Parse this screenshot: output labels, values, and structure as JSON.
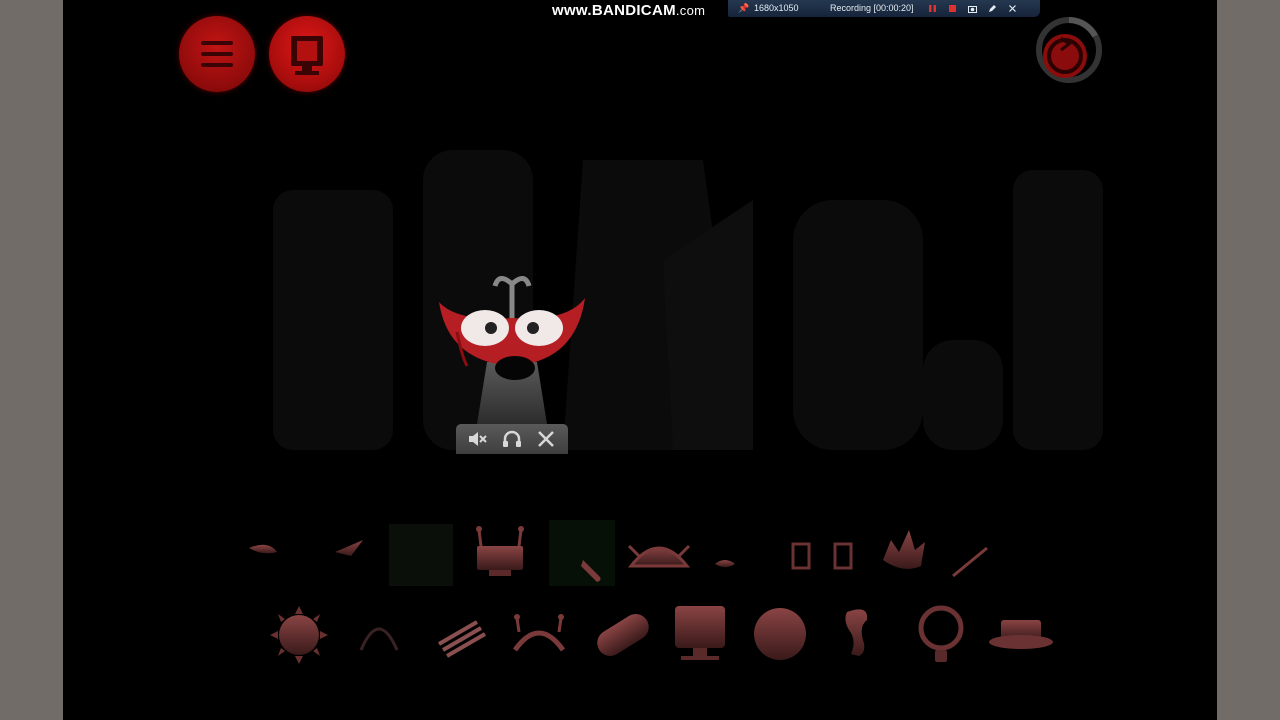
{
  "recorder": {
    "watermark_main": "www.BANDICAM",
    "watermark_domain": ".com",
    "resolution": "1680x1050",
    "status": "Recording [00:00:20]"
  },
  "controls": {
    "menu_icon": "hamburger-icon",
    "special_icon": "cup-icon",
    "reset_icon": "reset-ring-icon"
  },
  "mini_panel": {
    "icons": [
      "mute-icon",
      "headphones-icon",
      "close-icon"
    ]
  },
  "palette": {
    "row1": [
      "nose-icon",
      "beak-icon",
      "dark-box-icon",
      "antenna-screen-icon",
      "green-hook-icon",
      "horned-helmet-icon",
      "small-eye-icon",
      "goggles-icon",
      "spiky-hair-icon",
      "stick-icon"
    ],
    "row2": [
      "sun-face-icon",
      "arc-icon",
      "stripes-icon",
      "horned-eyes-icon",
      "pill-icon",
      "monitor-icon",
      "sphere-icon",
      "hook-figure-icon",
      "ring-icon",
      "hat-icon"
    ]
  },
  "colors": {
    "accent_red": "#c21414",
    "palette_tint": "#6e3434",
    "stage_bg": "#000000",
    "letterbox": "#726c69"
  }
}
